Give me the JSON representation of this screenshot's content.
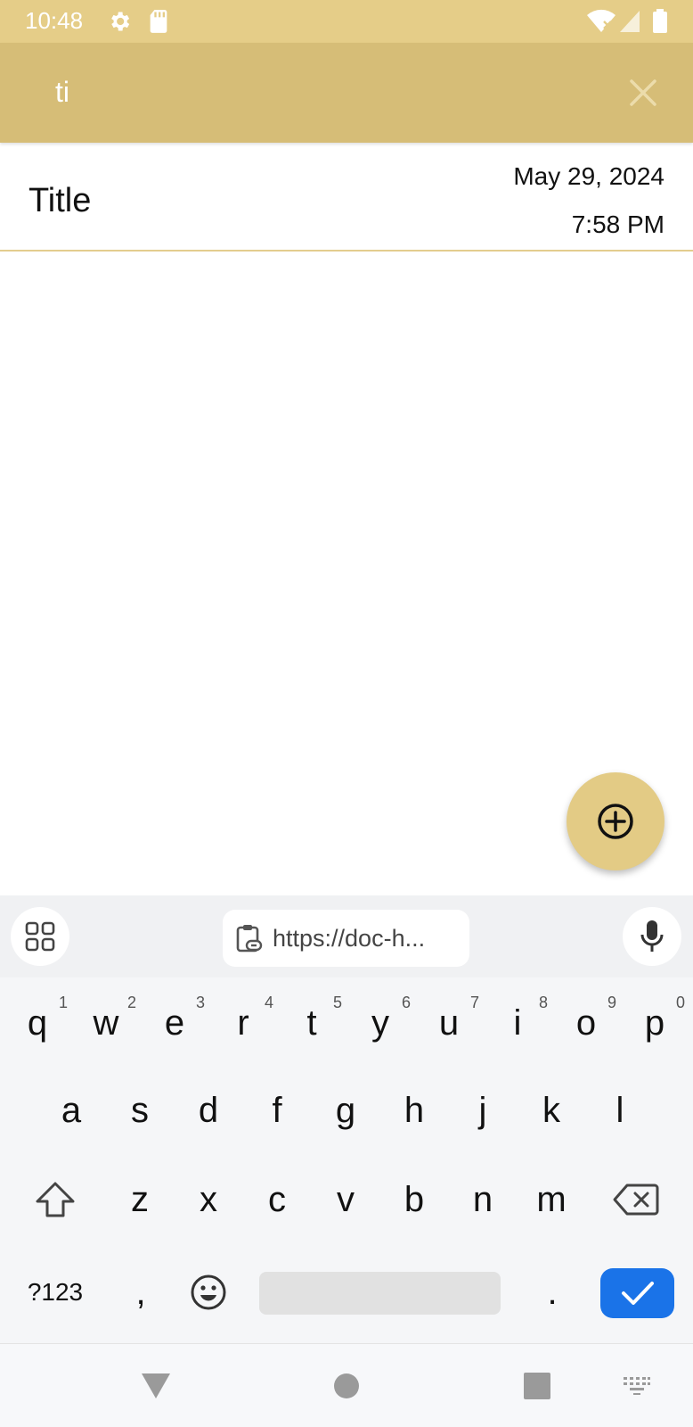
{
  "status_bar": {
    "time": "10:48",
    "icons": [
      "gear-icon",
      "sd-card-icon",
      "wifi-icon",
      "signal-icon",
      "battery-icon"
    ]
  },
  "search": {
    "query": "ti",
    "clear_icon": "close-icon"
  },
  "notes": [
    {
      "title": "Title",
      "date": "May 29, 2024",
      "time": "7:58 PM"
    }
  ],
  "fab": {
    "icon": "add-circle-icon"
  },
  "keyboard": {
    "clipboard_text": "https://doc-h...",
    "row1": [
      {
        "key": "q",
        "hint": "1"
      },
      {
        "key": "w",
        "hint": "2"
      },
      {
        "key": "e",
        "hint": "3"
      },
      {
        "key": "r",
        "hint": "4"
      },
      {
        "key": "t",
        "hint": "5"
      },
      {
        "key": "y",
        "hint": "6"
      },
      {
        "key": "u",
        "hint": "7"
      },
      {
        "key": "i",
        "hint": "8"
      },
      {
        "key": "o",
        "hint": "9"
      },
      {
        "key": "p",
        "hint": "0"
      }
    ],
    "row2": [
      "a",
      "s",
      "d",
      "f",
      "g",
      "h",
      "j",
      "k",
      "l"
    ],
    "row3": [
      "z",
      "x",
      "c",
      "v",
      "b",
      "n",
      "m"
    ],
    "symbols_label": "?123",
    "comma": ",",
    "period": "."
  },
  "colors": {
    "status_bar": "#e5cd88",
    "app_bar": "#d6bd77",
    "accent": "#e3cb85",
    "enter_key": "#1a73e8"
  }
}
